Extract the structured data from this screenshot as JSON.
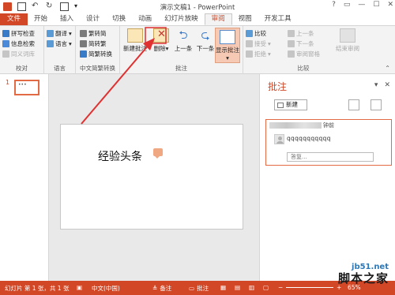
{
  "app": {
    "title": "演示文稿1 - PowerPoint",
    "window_controls": [
      "?",
      "▭",
      "—",
      "☐",
      "✕"
    ]
  },
  "tabs": [
    {
      "label": "文件"
    },
    {
      "label": "开始"
    },
    {
      "label": "插入"
    },
    {
      "label": "设计"
    },
    {
      "label": "切换"
    },
    {
      "label": "动画"
    },
    {
      "label": "幻灯片放映"
    },
    {
      "label": "审阅"
    },
    {
      "label": "视图"
    },
    {
      "label": "开发工具"
    }
  ],
  "ribbon": {
    "proofing": {
      "label": "校对",
      "spelling": "拼写检查",
      "research": "信息检索",
      "thesaurus": "同义词库"
    },
    "language": {
      "label": "语言",
      "translate": "翻译",
      "language": "语言"
    },
    "chinese_conversion": {
      "label": "中文简繁转换",
      "to_simplified": "繁转简",
      "to_traditional": "简转繁",
      "convert": "简繁转换"
    },
    "comments": {
      "label": "批注",
      "new": "新建批注",
      "delete": "删除",
      "previous": "上一条",
      "next": "下一条",
      "show": "显示批注"
    },
    "compare": {
      "label": "比较",
      "compare": "比较",
      "accept": "接受",
      "reject": "拒绝",
      "prev": "上一条",
      "next": "下一条",
      "reviewing_pane": "审阅窗格",
      "end_review": "结束审阅"
    }
  },
  "slides_pane": {
    "number": "1",
    "thumb_text": "•••"
  },
  "slide": {
    "text": "经验头条"
  },
  "comments_pane": {
    "title": "批注",
    "new_label": "新建",
    "comment": {
      "time": "钟前",
      "text": "qqqqqqqqqqq",
      "reply_placeholder": "答复..."
    }
  },
  "statusbar": {
    "slide_info": "幻灯片 第 1 张，共 1 张",
    "language": "中文(中国)",
    "notes": "备注",
    "comments": "批注",
    "zoom": "65%"
  },
  "watermark": {
    "site": "jb51.net",
    "name": "脚本之家"
  },
  "colors": {
    "accent": "#d24726",
    "ribbon_bg": "#f3f3f3",
    "arrow": "#e03030"
  }
}
